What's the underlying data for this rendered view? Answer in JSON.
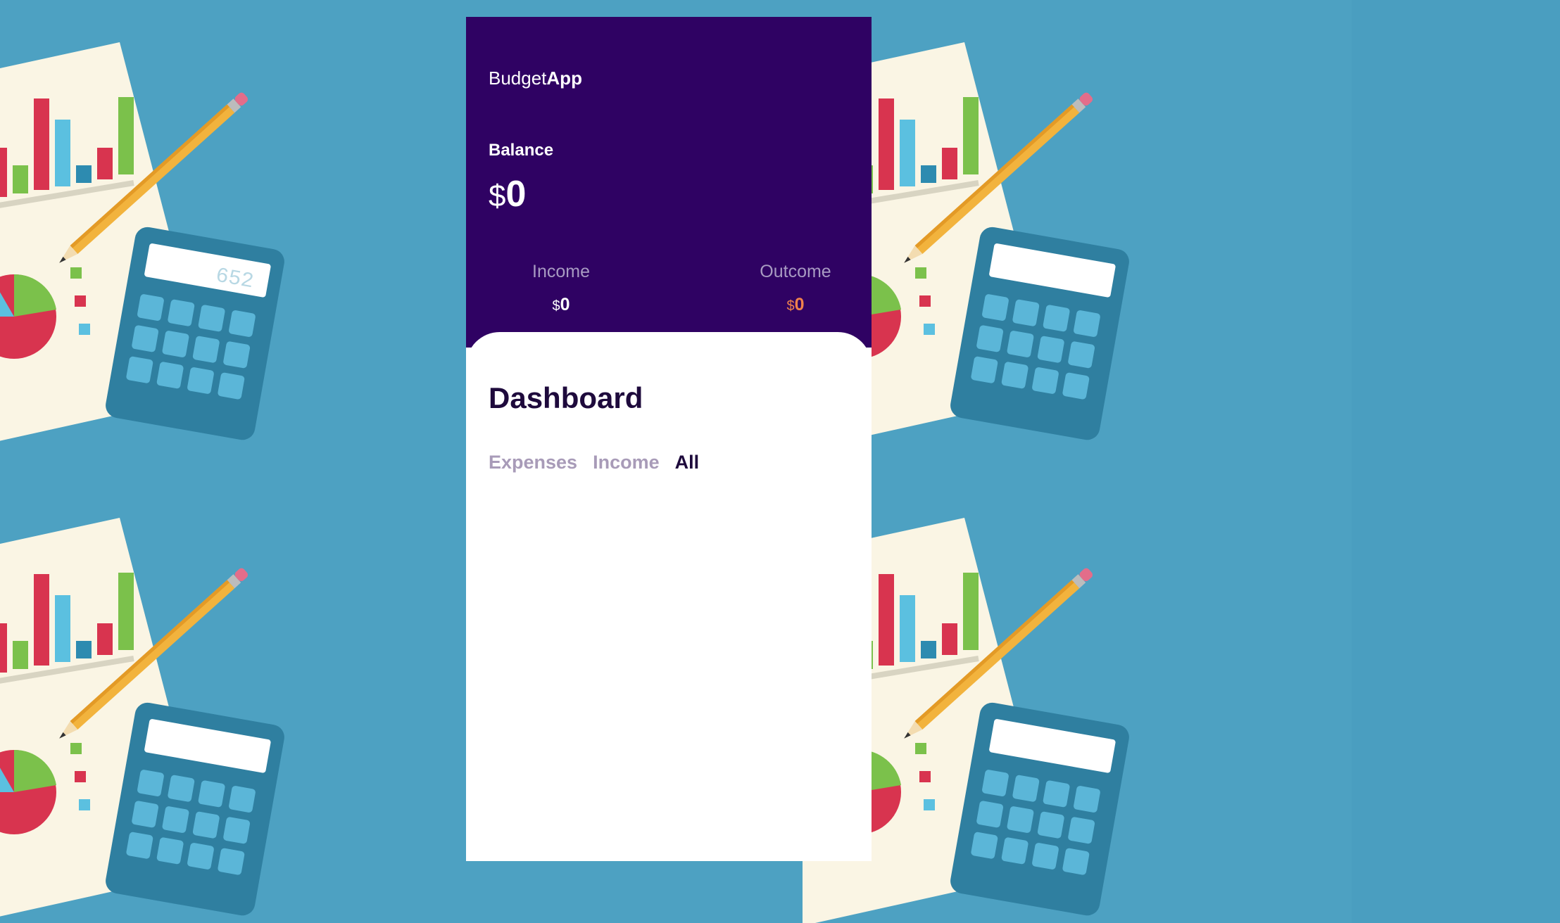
{
  "app": {
    "brand_light": "Budget",
    "brand_bold": "App"
  },
  "balance": {
    "label": "Balance",
    "currency": "$",
    "amount": "0"
  },
  "income": {
    "label": "Income",
    "currency": "$",
    "amount": "0"
  },
  "outcome": {
    "label": "Outcome",
    "currency": "$",
    "amount": "0"
  },
  "dashboard": {
    "title": "Dashboard",
    "tabs": [
      {
        "label": "Expenses",
        "active": false
      },
      {
        "label": "Income",
        "active": false
      },
      {
        "label": "All",
        "active": true
      }
    ]
  },
  "background_calculator_display": "652",
  "colors": {
    "background": "#4a9ec0",
    "header": "#2f0263",
    "title_text": "#1e0a3c",
    "inactive_tab": "#a89bb8",
    "outcome_accent": "#f0824c"
  }
}
